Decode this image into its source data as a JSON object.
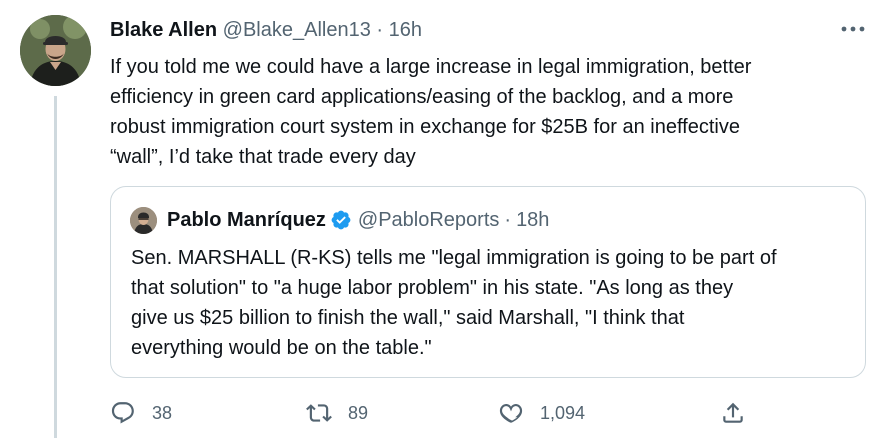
{
  "tweet": {
    "author_name": "Blake Allen",
    "author_handle": "@Blake_Allen13",
    "separator": "·",
    "time": "16h",
    "text_lines": [
      "If you told me we could have a large increase in legal immigration, better",
      "efficiency in green card applications/easing of the backlog, and a more",
      "robust immigration court system in exchange for $25B for an ineffective",
      "“wall”, I’d take that trade every day"
    ],
    "more_icon": "more-horizontal-icon",
    "avatar_icon": "user-avatar"
  },
  "quote": {
    "author_name": "Pablo Manríquez",
    "author_handle": "@PabloReports",
    "separator": "·",
    "time": "18h",
    "verified_icon": "verified-badge-icon",
    "text_lines": [
      "Sen. MARSHALL (R-KS) tells me \"legal immigration is going to be part of",
      "that solution\" to \"a huge labor problem\" in his state. \"As long as they",
      "give us $25 billion to finish the wall,\" said Marshall, \"I think that",
      "everything would be on the table.\""
    ]
  },
  "actions": {
    "reply": {
      "icon": "reply-icon",
      "count": "38"
    },
    "retweet": {
      "icon": "retweet-icon",
      "count": "89"
    },
    "like": {
      "icon": "like-icon",
      "count": "1,094"
    },
    "share": {
      "icon": "share-icon"
    }
  },
  "colors": {
    "text": "#0f1419",
    "secondary": "#536471",
    "border": "#cfd9de",
    "verified": "#1d9bf0"
  }
}
